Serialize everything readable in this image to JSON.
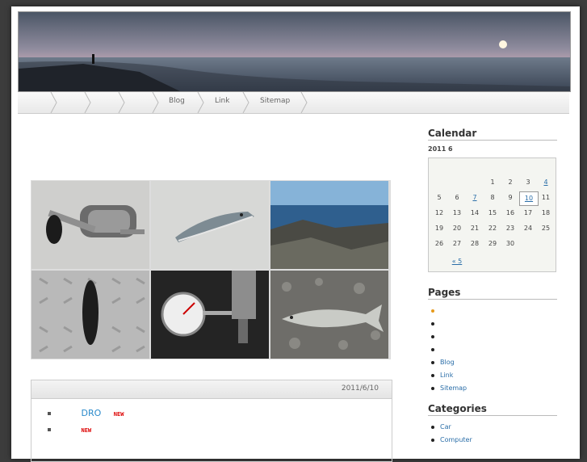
{
  "nav": {
    "items": [
      "",
      "",
      "",
      "",
      "Blog",
      "Link",
      "Sitemap"
    ]
  },
  "post": {
    "date": "2011/6/10",
    "rows": [
      {
        "label": "DRO",
        "badge": "NEW"
      },
      {
        "label": "",
        "badge": "NEW"
      }
    ]
  },
  "sidebar": {
    "calendar_heading": "Calendar",
    "calendar_title": "2011  6",
    "calendar_rows": [
      [
        "",
        "",
        "",
        "1",
        "2",
        "3",
        "4"
      ],
      [
        "5",
        "6",
        "7",
        "8",
        "9",
        "10",
        "11"
      ],
      [
        "12",
        "13",
        "14",
        "15",
        "16",
        "17",
        "18"
      ],
      [
        "19",
        "20",
        "21",
        "22",
        "23",
        "24",
        "25"
      ],
      [
        "26",
        "27",
        "28",
        "29",
        "30",
        "",
        ""
      ]
    ],
    "calendar_links": [
      "4",
      "7",
      "10"
    ],
    "calendar_today": "10",
    "calendar_prev": "« 5",
    "pages_heading": "Pages",
    "pages": [
      "",
      "",
      "",
      "",
      "Blog",
      "Link",
      "Sitemap"
    ],
    "categories_heading": "Categories",
    "categories": [
      "Car",
      "Computer"
    ]
  },
  "colors": {
    "link": "#2a6ea8",
    "new_badge": "#dd0000",
    "page_bullet_active": "#e69a1c"
  }
}
